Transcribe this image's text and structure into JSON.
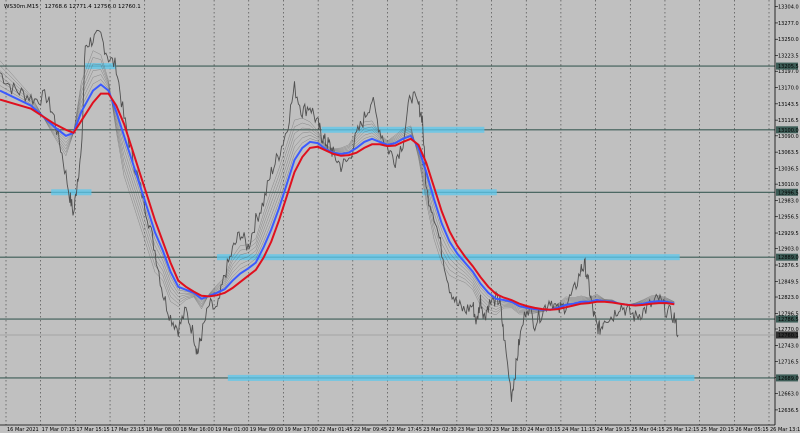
{
  "header": {
    "symbol": "WS30m.M15",
    "ohlc": "12768.6  12771.4  12756.0  12760.1"
  },
  "colors": {
    "background": "#c0c0c0",
    "price_line": "#505050",
    "ma_fast": "#3b5bff",
    "ma_slow": "#e0101e",
    "ribbon": "#606060",
    "hline": "#3c5c56",
    "zone": "#5bc8ee",
    "current_price_line": "#8a8a8a"
  },
  "chart_data": {
    "type": "line",
    "title": "",
    "xlabel": "",
    "ylabel": "",
    "ylim": [
      12611.0,
      13315.0
    ],
    "grid": true,
    "y_ticks": [
      13304.0,
      13277.0,
      13250.0,
      13223.0,
      13197.0,
      13170.0,
      13143.0,
      13116.0,
      13090.0,
      13063.0,
      13036.0,
      13010.0,
      12983.0,
      12956.0,
      12929.0,
      12903.0,
      12876.0,
      12849.0,
      12823.0,
      12796.0,
      12770.0,
      12743.0,
      12716.0,
      12690.0,
      12663.0,
      12636.0
    ],
    "y_tick_labels": [
      "13304.0",
      "13277.0",
      "13250.0",
      "13223.5",
      "13197.0",
      "13170.0",
      "13143.5",
      "13116.5",
      "13090.0",
      "13063.5",
      "13036.5",
      "13010.0",
      "12983.0",
      "12956.5",
      "12929.5",
      "12903.0",
      "12876.5",
      "12849.5",
      "12823.0",
      "12796.5",
      "12770.0",
      "12743.0",
      "12716.5",
      "12690.0",
      "12663.0",
      "12636.5"
    ],
    "x_tick_labels": [
      "16 Mar 2021",
      "17 Mar 07:15",
      "17 Mar 15:15",
      "17 Mar 23:15",
      "18 Mar 08:00",
      "18 Mar 16:00",
      "19 Mar 01:00",
      "19 Mar 09:00",
      "19 Mar 17:00",
      "22 Mar 01:45",
      "22 Mar 09:45",
      "22 Mar 17:45",
      "23 Mar 02:30",
      "23 Mar 10:30",
      "23 Mar 18:30",
      "24 Mar 03:15",
      "24 Mar 11:15",
      "24 Mar 19:15",
      "25 Mar 04:15",
      "25 Mar 12:15",
      "25 Mar 20:15",
      "26 Mar 05:15",
      "26 Mar 13:15"
    ],
    "horizontal_levels": [
      {
        "price": 13205.5,
        "label": "13205.5"
      },
      {
        "price": 13100.0,
        "label": "13100.0"
      },
      {
        "price": 12996.5,
        "label": "12996.5"
      },
      {
        "price": 12889.0,
        "label": "12889.0"
      },
      {
        "price": 12786.5,
        "label": "12786.5"
      },
      {
        "price": 12689.0,
        "label": "12689.0"
      }
    ],
    "current_price": {
      "price": 12760.1,
      "label": "12760.1"
    },
    "zones": [
      {
        "price": 13205.5,
        "t_start": 0.11,
        "t_end": 0.15
      },
      {
        "price": 13100.0,
        "t_start": 0.415,
        "t_end": 0.625
      },
      {
        "price": 12996.5,
        "t_start": 0.066,
        "t_end": 0.118
      },
      {
        "price": 12996.5,
        "t_start": 0.545,
        "t_end": 0.641
      },
      {
        "price": 12889.0,
        "t_start": 0.28,
        "t_end": 0.877
      },
      {
        "price": 12689.0,
        "t_start": 0.294,
        "t_end": 0.896
      }
    ],
    "series": [
      {
        "role": "price",
        "t": [
          0.0,
          0.015,
          0.03,
          0.045,
          0.06,
          0.07,
          0.08,
          0.09,
          0.095,
          0.1,
          0.105,
          0.11,
          0.12,
          0.13,
          0.14,
          0.15,
          0.16,
          0.17,
          0.18,
          0.19,
          0.2,
          0.21,
          0.22,
          0.23,
          0.24,
          0.25,
          0.255,
          0.26,
          0.27,
          0.28,
          0.29,
          0.3,
          0.31,
          0.32,
          0.33,
          0.34,
          0.35,
          0.36,
          0.37,
          0.38,
          0.39,
          0.4,
          0.41,
          0.415,
          0.42,
          0.425,
          0.43,
          0.44,
          0.45,
          0.46,
          0.47,
          0.48,
          0.49,
          0.5,
          0.51,
          0.52,
          0.53,
          0.54,
          0.545,
          0.55,
          0.56,
          0.57,
          0.58,
          0.59,
          0.6,
          0.61,
          0.615,
          0.62,
          0.625,
          0.63,
          0.64,
          0.645,
          0.65,
          0.66,
          0.665,
          0.67,
          0.68,
          0.69,
          0.7,
          0.71,
          0.72,
          0.73,
          0.74,
          0.75,
          0.755,
          0.76,
          0.765,
          0.77,
          0.775,
          0.78,
          0.79,
          0.8,
          0.81,
          0.82,
          0.83,
          0.84,
          0.85,
          0.86,
          0.87,
          0.875
        ],
        "values": [
          13195,
          13170,
          13160,
          13150,
          13155,
          13120,
          13060,
          12990,
          12960,
          13020,
          13060,
          13240,
          13250,
          13255,
          13220,
          13205,
          13120,
          13060,
          13010,
          12960,
          12900,
          12830,
          12790,
          12770,
          12800,
          12760,
          12730,
          12760,
          12810,
          12800,
          12860,
          12900,
          12930,
          12905,
          12950,
          12980,
          13030,
          13060,
          13100,
          13170,
          13130,
          13140,
          13110,
          13090,
          13080,
          13075,
          13060,
          13040,
          13050,
          13090,
          13120,
          13150,
          13100,
          13070,
          13050,
          13080,
          13160,
          13140,
          13120,
          13000,
          12960,
          12900,
          12840,
          12810,
          12800,
          12810,
          12780,
          12820,
          12790,
          12810,
          12820,
          12815,
          12760,
          12660,
          12700,
          12750,
          12810,
          12780,
          12800,
          12820,
          12800,
          12810,
          12830,
          12870,
          12875,
          12840,
          12800,
          12775,
          12770,
          12790,
          12790,
          12810,
          12800,
          12790,
          12800,
          12810,
          12820,
          12800,
          12790,
          12760
        ]
      },
      {
        "role": "ma-fast",
        "t": [
          0.0,
          0.04,
          0.07,
          0.085,
          0.095,
          0.105,
          0.12,
          0.13,
          0.14,
          0.15,
          0.16,
          0.17,
          0.18,
          0.19,
          0.2,
          0.21,
          0.22,
          0.23,
          0.24,
          0.25,
          0.26,
          0.27,
          0.28,
          0.29,
          0.3,
          0.31,
          0.32,
          0.33,
          0.34,
          0.35,
          0.36,
          0.37,
          0.38,
          0.39,
          0.4,
          0.41,
          0.42,
          0.43,
          0.44,
          0.45,
          0.46,
          0.47,
          0.48,
          0.49,
          0.5,
          0.51,
          0.52,
          0.53,
          0.54,
          0.55,
          0.56,
          0.57,
          0.58,
          0.59,
          0.6,
          0.61,
          0.62,
          0.63,
          0.64,
          0.65,
          0.66,
          0.67,
          0.68,
          0.69,
          0.7,
          0.71,
          0.72,
          0.73,
          0.74,
          0.75,
          0.76,
          0.77,
          0.78,
          0.79,
          0.8,
          0.81,
          0.82,
          0.83,
          0.84,
          0.85,
          0.86,
          0.87
        ],
        "values": [
          13165,
          13140,
          13105,
          13090,
          13095,
          13130,
          13165,
          13175,
          13165,
          13130,
          13090,
          13050,
          13010,
          12970,
          12930,
          12900,
          12865,
          12840,
          12835,
          12830,
          12820,
          12825,
          12830,
          12836,
          12850,
          12862,
          12870,
          12880,
          12905,
          12935,
          12970,
          13010,
          13050,
          13070,
          13080,
          13078,
          13068,
          13062,
          13060,
          13062,
          13070,
          13080,
          13085,
          13080,
          13075,
          13078,
          13085,
          13090,
          13070,
          13030,
          12985,
          12945,
          12915,
          12895,
          12880,
          12865,
          12845,
          12830,
          12820,
          12818,
          12815,
          12808,
          12805,
          12803,
          12802,
          12802,
          12805,
          12810,
          12812,
          12815,
          12815,
          12818,
          12816,
          12815,
          12812,
          12810,
          12810,
          12812,
          12815,
          12816,
          12815,
          12812
        ]
      },
      {
        "role": "ma-slow",
        "t": [
          0.0,
          0.04,
          0.07,
          0.085,
          0.095,
          0.105,
          0.12,
          0.13,
          0.14,
          0.15,
          0.16,
          0.17,
          0.18,
          0.19,
          0.2,
          0.21,
          0.22,
          0.23,
          0.24,
          0.25,
          0.26,
          0.27,
          0.28,
          0.29,
          0.3,
          0.31,
          0.32,
          0.33,
          0.34,
          0.35,
          0.36,
          0.37,
          0.38,
          0.39,
          0.4,
          0.41,
          0.42,
          0.43,
          0.44,
          0.45,
          0.46,
          0.47,
          0.48,
          0.49,
          0.5,
          0.51,
          0.52,
          0.53,
          0.54,
          0.55,
          0.56,
          0.57,
          0.58,
          0.59,
          0.6,
          0.61,
          0.62,
          0.63,
          0.64,
          0.65,
          0.66,
          0.67,
          0.68,
          0.69,
          0.7,
          0.71,
          0.72,
          0.73,
          0.74,
          0.75,
          0.76,
          0.77,
          0.78,
          0.79,
          0.8,
          0.81,
          0.82,
          0.83,
          0.84,
          0.85,
          0.86,
          0.87
        ],
        "values": [
          13150,
          13135,
          13110,
          13100,
          13095,
          13115,
          13145,
          13160,
          13160,
          13140,
          13110,
          13070,
          13030,
          12990,
          12950,
          12915,
          12880,
          12850,
          12840,
          12832,
          12825,
          12824,
          12826,
          12830,
          12838,
          12848,
          12858,
          12868,
          12888,
          12915,
          12950,
          12990,
          13030,
          13055,
          13070,
          13072,
          13066,
          13060,
          13057,
          13058,
          13062,
          13070,
          13076,
          13076,
          13073,
          13074,
          13080,
          13085,
          13075,
          13045,
          13005,
          12965,
          12932,
          12908,
          12890,
          12874,
          12856,
          12840,
          12828,
          12822,
          12818,
          12812,
          12808,
          12805,
          12803,
          12802,
          12803,
          12806,
          12809,
          12812,
          12813,
          12815,
          12815,
          12814,
          12812,
          12810,
          12809,
          12810,
          12812,
          12813,
          12813,
          12811
        ]
      }
    ]
  }
}
